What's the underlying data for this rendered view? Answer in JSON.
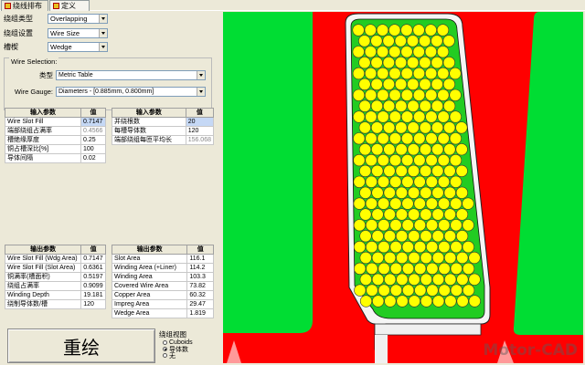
{
  "tabs": [
    {
      "label": "绕线排布",
      "active": false
    },
    {
      "label": "定义",
      "active": true
    }
  ],
  "settings": {
    "winding_type": {
      "label": "绕组类型",
      "value": "Overlapping"
    },
    "winding_setting": {
      "label": "绕组设置",
      "value": "Wire Size"
    },
    "slot_wedge": {
      "label": "槽楔",
      "value": "Wedge"
    }
  },
  "wire_selection": {
    "title": "Wire Selection:",
    "type_label": "类型",
    "type_value": "Metric Table",
    "gauge_label": "Wire Gauge:",
    "gauge_value": "Diameters  -  [0.885mm, 0.800mm]"
  },
  "input_table_1": {
    "headers": [
      "输入参数",
      "值"
    ],
    "rows": [
      {
        "name": "Wire Slot Fill",
        "value": "0.7147"
      },
      {
        "name": "端部绕组占满率",
        "value": "0.4566"
      },
      {
        "name": "槽绝缘厚度",
        "value": "0.25"
      },
      {
        "name": "铜占槽深比[%]",
        "value": "100"
      },
      {
        "name": "导体间隔",
        "value": "0.02"
      }
    ]
  },
  "input_table_2": {
    "headers": [
      "输入参数",
      "值"
    ],
    "rows": [
      {
        "name": "并绕根数",
        "value": "20"
      },
      {
        "name": "每槽导体数",
        "value": "120"
      },
      {
        "name": "端部绕组每匝平均长",
        "value": "156.068"
      }
    ]
  },
  "output_table_1": {
    "headers": [
      "输出参数",
      "值"
    ],
    "rows": [
      {
        "name": "Wire Slot Fill (Wdg Area)",
        "value": "0.7147"
      },
      {
        "name": "Wire Slot Fill (Slot Area)",
        "value": "0.6361"
      },
      {
        "name": "铜满率(槽面积)",
        "value": "0.5197"
      },
      {
        "name": "绕组占满率",
        "value": "0.9099"
      },
      {
        "name": "Winding Depth",
        "value": "19.181"
      },
      {
        "name": "绕制导体数/槽",
        "value": "120"
      }
    ]
  },
  "output_table_2": {
    "headers": [
      "输出参数",
      "值"
    ],
    "rows": [
      {
        "name": "Slot Area",
        "value": "116.1"
      },
      {
        "name": "Winding Area (+Liner)",
        "value": "114.2"
      },
      {
        "name": "Winding Area",
        "value": "103.3"
      },
      {
        "name": "Covered Wire Area",
        "value": "73.82"
      },
      {
        "name": "Copper Area",
        "value": "60.32"
      },
      {
        "name": "Impreg Area",
        "value": "29.47"
      },
      {
        "name": "Wedge Area",
        "value": "1.819"
      }
    ]
  },
  "redraw_button": "重绘",
  "winding_view": {
    "title": "绕组视图",
    "options": [
      {
        "label": "Cuboids",
        "selected": false
      },
      {
        "label": "导体数",
        "selected": true
      },
      {
        "label": "无",
        "selected": false
      }
    ]
  },
  "watermark": "Motor-CAD",
  "colors": {
    "tooth": "#00dd33",
    "background": "#ff0000",
    "conductor_fill": "#ffff00",
    "insulation": "#f5f5f5",
    "winding_bg": "#22cc22"
  }
}
